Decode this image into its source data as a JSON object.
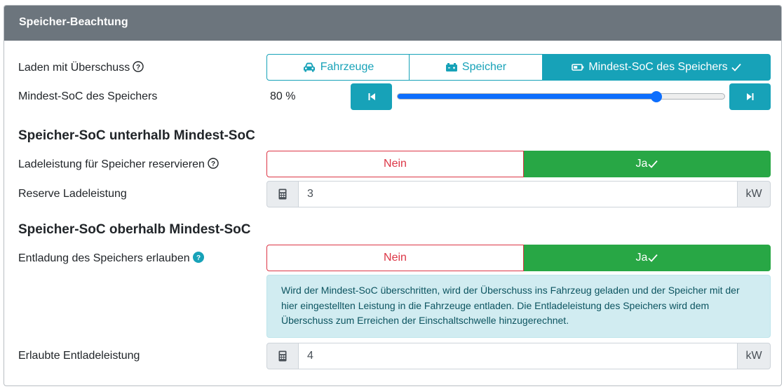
{
  "header": {
    "title": "Speicher-Beachtung"
  },
  "colors": {
    "info": "#17a2b8",
    "success": "#28a745",
    "danger": "#dc3545",
    "header_bg": "#6c757d",
    "slider": "#0d6efd"
  },
  "surplus": {
    "label": "Laden mit Überschuss",
    "help_icon": "question-circle-icon",
    "options": [
      {
        "label": "Fahrzeuge",
        "icon": "car-icon",
        "selected": false
      },
      {
        "label": "Speicher",
        "icon": "battery-car-icon",
        "selected": false
      },
      {
        "label": "Mindest-SoC des Speichers",
        "icon": "battery-icon",
        "selected": true
      }
    ],
    "check_mark": "✓"
  },
  "min_soc": {
    "label": "Mindest-SoC des Speichers",
    "value_text": "80 %",
    "value": 80,
    "min": 0,
    "max": 100
  },
  "below": {
    "heading": "Speicher-SoC unterhalb Mindest-SoC",
    "reserve_label": "Ladeleistung für Speicher reservieren",
    "no": "Nein",
    "yes": "Ja",
    "reserve_power_label": "Reserve Ladeleistung",
    "reserve_power_value": "3",
    "unit": "kW"
  },
  "above": {
    "heading": "Speicher-SoC oberhalb Mindest-SoC",
    "discharge_label": "Entladung des Speichers erlauben",
    "no": "Nein",
    "yes": "Ja",
    "info_lines": [
      "Wird der Mindest-SoC überschritten, wird der Überschuss ins Fahrzeug geladen und der Speicher mit der",
      "hier eingestellten Leistung in die Fahrzeuge entladen. Die Entladeleistung des Speichers wird dem",
      "Überschuss zum Erreichen der Einschaltschwelle hinzugerechnet."
    ],
    "discharge_power_label": "Erlaubte Entladeleistung",
    "discharge_power_value": "4",
    "unit": "kW"
  }
}
